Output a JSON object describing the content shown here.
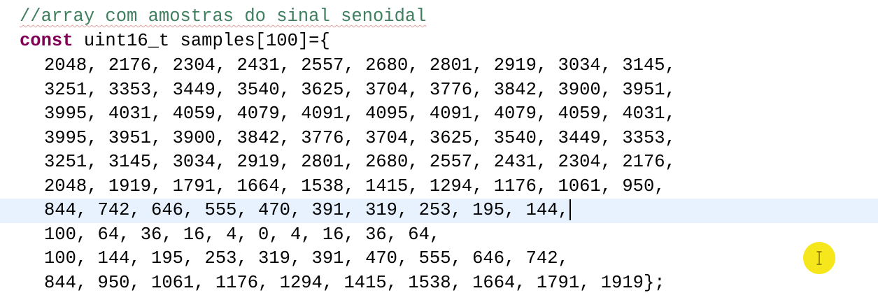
{
  "editor": {
    "comment": "//array com amostras do sinal senoidal",
    "declaration": {
      "keyword": "const",
      "rest": " uint16_t samples[100]={"
    },
    "lines": [
      "2048, 2176, 2304, 2431, 2557, 2680, 2801, 2919, 3034, 3145,",
      "3251, 3353, 3449, 3540, 3625, 3704, 3776, 3842, 3900, 3951,",
      "3995, 4031, 4059, 4079, 4091, 4095, 4091, 4079, 4059, 4031,",
      "3995, 3951, 3900, 3842, 3776, 3704, 3625, 3540, 3449, 3353,",
      "3251, 3145, 3034, 2919, 2801, 2680, 2557, 2431, 2304, 2176,",
      "2048, 1919, 1791, 1664, 1538, 1415, 1294, 1176, 1061, 950,",
      "844, 742, 646, 555, 470, 391, 319, 253, 195, 144,",
      "100, 64, 36, 16, 4, 0, 4, 16, 36, 64,",
      "100, 144, 195, 253, 319, 391, 470, 555, 646, 742,",
      "844, 950, 1061, 1176, 1294, 1415, 1538, 1664, 1791, 1919};"
    ],
    "current_line_index": 6
  },
  "colors": {
    "comment": "#3f7f5f",
    "keyword": "#7f0055",
    "current_line_highlight": "#e8f2fe",
    "cursor_halo": "#f5e50a"
  },
  "icons": {
    "mouse_cursor": "i-beam-cursor-icon"
  }
}
